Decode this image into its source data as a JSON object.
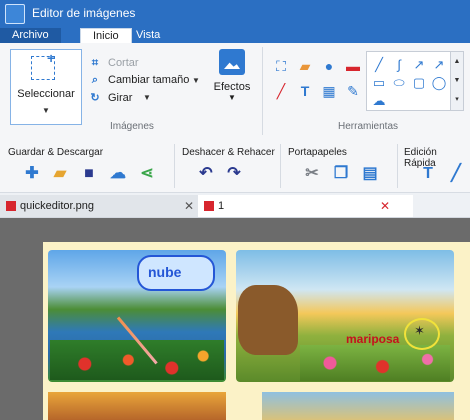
{
  "window": {
    "title": "Editor de imágenes"
  },
  "tabs": [
    {
      "label": "Archivo"
    },
    {
      "label": "Inicio"
    },
    {
      "label": "Vista"
    }
  ],
  "ribbon": {
    "select_label": "Seleccionar",
    "images_group_label": "Imágenes",
    "tools_group_label": "Herramientas",
    "commands": {
      "crop": "Cortar",
      "resize": "Cambiar tamaño",
      "rotate": "Girar"
    },
    "effects_label": "Efectos"
  },
  "toolbar2": {
    "save_download": "Guardar & Descargar",
    "undo_redo": "Deshacer & Rehacer",
    "clipboard": "Portapapeles",
    "quick_edit": "Edición Rápida"
  },
  "doc_tabs": [
    {
      "label": "quickeditor.png"
    },
    {
      "label": "1"
    }
  ],
  "canvas": {
    "bubble_text": "nube",
    "butterfly_text": "mariposa"
  },
  "colors": {
    "titlebar": "#2b6fc2",
    "accent": "#2f79d0",
    "close_red": "#d7262e"
  }
}
